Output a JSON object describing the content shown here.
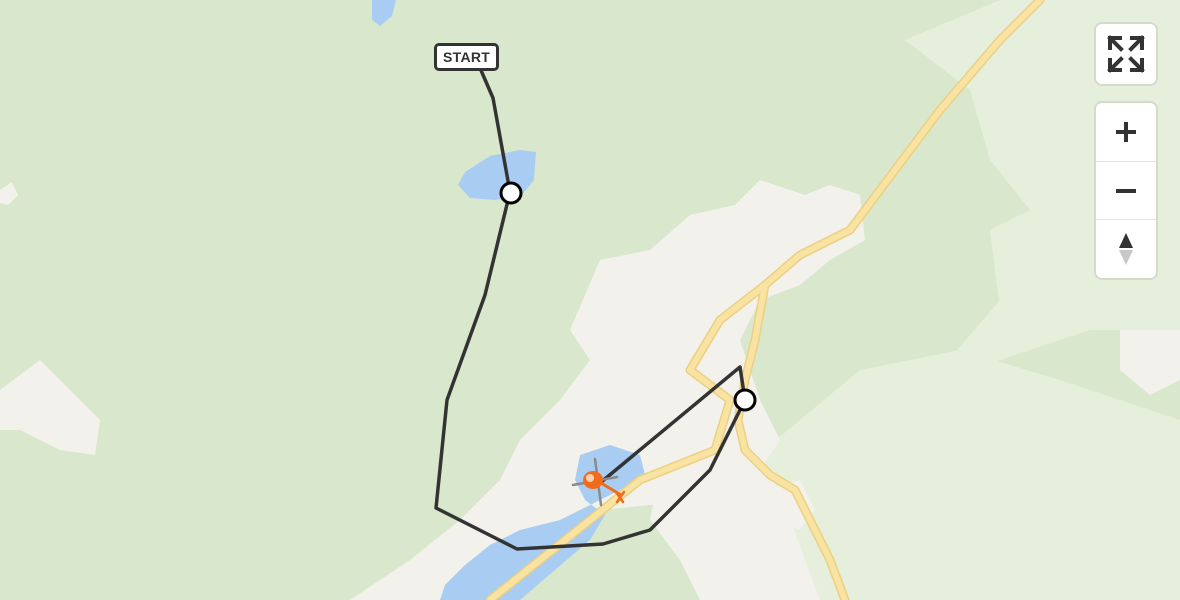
{
  "map": {
    "colors": {
      "forest": "#d9e8cc",
      "clearing": "#f3f1ec",
      "meadow": "#e6eedc",
      "water": "#a9cdf2",
      "road": "#f6dc8f",
      "route": "#333333",
      "helicopter": "#f26b1d"
    }
  },
  "route": {
    "start_label": "START",
    "waypoints": [
      "waypoint-1",
      "waypoint-2"
    ],
    "end_marker": "helicopter-icon"
  },
  "controls": {
    "fullscreen": "fullscreen-icon",
    "zoom_in": "plus-icon",
    "zoom_out": "minus-icon",
    "reset_north": "compass-icon"
  }
}
